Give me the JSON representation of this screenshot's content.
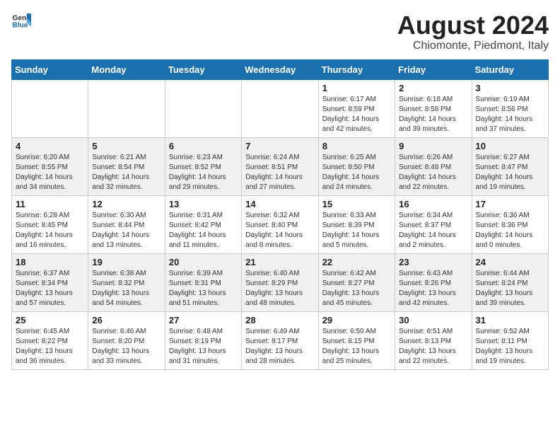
{
  "header": {
    "logo_general": "General",
    "logo_blue": "Blue",
    "month_year": "August 2024",
    "location": "Chiomonte, Piedmont, Italy"
  },
  "days_of_week": [
    "Sunday",
    "Monday",
    "Tuesday",
    "Wednesday",
    "Thursday",
    "Friday",
    "Saturday"
  ],
  "weeks": [
    [
      {
        "day": "",
        "info": ""
      },
      {
        "day": "",
        "info": ""
      },
      {
        "day": "",
        "info": ""
      },
      {
        "day": "",
        "info": ""
      },
      {
        "day": "1",
        "info": "Sunrise: 6:17 AM\nSunset: 8:59 PM\nDaylight: 14 hours\nand 42 minutes."
      },
      {
        "day": "2",
        "info": "Sunrise: 6:18 AM\nSunset: 8:58 PM\nDaylight: 14 hours\nand 39 minutes."
      },
      {
        "day": "3",
        "info": "Sunrise: 6:19 AM\nSunset: 8:56 PM\nDaylight: 14 hours\nand 37 minutes."
      }
    ],
    [
      {
        "day": "4",
        "info": "Sunrise: 6:20 AM\nSunset: 8:55 PM\nDaylight: 14 hours\nand 34 minutes."
      },
      {
        "day": "5",
        "info": "Sunrise: 6:21 AM\nSunset: 8:54 PM\nDaylight: 14 hours\nand 32 minutes."
      },
      {
        "day": "6",
        "info": "Sunrise: 6:23 AM\nSunset: 8:52 PM\nDaylight: 14 hours\nand 29 minutes."
      },
      {
        "day": "7",
        "info": "Sunrise: 6:24 AM\nSunset: 8:51 PM\nDaylight: 14 hours\nand 27 minutes."
      },
      {
        "day": "8",
        "info": "Sunrise: 6:25 AM\nSunset: 8:50 PM\nDaylight: 14 hours\nand 24 minutes."
      },
      {
        "day": "9",
        "info": "Sunrise: 6:26 AM\nSunset: 8:48 PM\nDaylight: 14 hours\nand 22 minutes."
      },
      {
        "day": "10",
        "info": "Sunrise: 6:27 AM\nSunset: 8:47 PM\nDaylight: 14 hours\nand 19 minutes."
      }
    ],
    [
      {
        "day": "11",
        "info": "Sunrise: 6:28 AM\nSunset: 8:45 PM\nDaylight: 14 hours\nand 16 minutes."
      },
      {
        "day": "12",
        "info": "Sunrise: 6:30 AM\nSunset: 8:44 PM\nDaylight: 14 hours\nand 13 minutes."
      },
      {
        "day": "13",
        "info": "Sunrise: 6:31 AM\nSunset: 8:42 PM\nDaylight: 14 hours\nand 11 minutes."
      },
      {
        "day": "14",
        "info": "Sunrise: 6:32 AM\nSunset: 8:40 PM\nDaylight: 14 hours\nand 8 minutes."
      },
      {
        "day": "15",
        "info": "Sunrise: 6:33 AM\nSunset: 8:39 PM\nDaylight: 14 hours\nand 5 minutes."
      },
      {
        "day": "16",
        "info": "Sunrise: 6:34 AM\nSunset: 8:37 PM\nDaylight: 14 hours\nand 2 minutes."
      },
      {
        "day": "17",
        "info": "Sunrise: 6:36 AM\nSunset: 8:36 PM\nDaylight: 14 hours\nand 0 minutes."
      }
    ],
    [
      {
        "day": "18",
        "info": "Sunrise: 6:37 AM\nSunset: 8:34 PM\nDaylight: 13 hours\nand 57 minutes."
      },
      {
        "day": "19",
        "info": "Sunrise: 6:38 AM\nSunset: 8:32 PM\nDaylight: 13 hours\nand 54 minutes."
      },
      {
        "day": "20",
        "info": "Sunrise: 6:39 AM\nSunset: 8:31 PM\nDaylight: 13 hours\nand 51 minutes."
      },
      {
        "day": "21",
        "info": "Sunrise: 6:40 AM\nSunset: 8:29 PM\nDaylight: 13 hours\nand 48 minutes."
      },
      {
        "day": "22",
        "info": "Sunrise: 6:42 AM\nSunset: 8:27 PM\nDaylight: 13 hours\nand 45 minutes."
      },
      {
        "day": "23",
        "info": "Sunrise: 6:43 AM\nSunset: 8:26 PM\nDaylight: 13 hours\nand 42 minutes."
      },
      {
        "day": "24",
        "info": "Sunrise: 6:44 AM\nSunset: 8:24 PM\nDaylight: 13 hours\nand 39 minutes."
      }
    ],
    [
      {
        "day": "25",
        "info": "Sunrise: 6:45 AM\nSunset: 8:22 PM\nDaylight: 13 hours\nand 36 minutes."
      },
      {
        "day": "26",
        "info": "Sunrise: 6:46 AM\nSunset: 8:20 PM\nDaylight: 13 hours\nand 33 minutes."
      },
      {
        "day": "27",
        "info": "Sunrise: 6:48 AM\nSunset: 8:19 PM\nDaylight: 13 hours\nand 31 minutes."
      },
      {
        "day": "28",
        "info": "Sunrise: 6:49 AM\nSunset: 8:17 PM\nDaylight: 13 hours\nand 28 minutes."
      },
      {
        "day": "29",
        "info": "Sunrise: 6:50 AM\nSunset: 8:15 PM\nDaylight: 13 hours\nand 25 minutes."
      },
      {
        "day": "30",
        "info": "Sunrise: 6:51 AM\nSunset: 8:13 PM\nDaylight: 13 hours\nand 22 minutes."
      },
      {
        "day": "31",
        "info": "Sunrise: 6:52 AM\nSunset: 8:11 PM\nDaylight: 13 hours\nand 19 minutes."
      }
    ]
  ]
}
